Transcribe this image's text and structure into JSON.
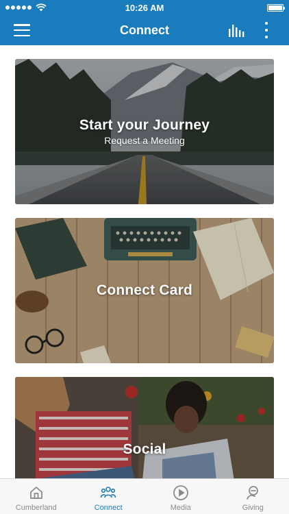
{
  "status_bar": {
    "time": "10:26 AM"
  },
  "header": {
    "title": "Connect"
  },
  "cards": [
    {
      "title": "Start your Journey",
      "subtitle": "Request a Meeting"
    },
    {
      "title": "Connect Card",
      "subtitle": ""
    },
    {
      "title": "Social",
      "subtitle": ""
    }
  ],
  "tabs": [
    {
      "label": "Cumberland",
      "icon": "home-icon",
      "active": false
    },
    {
      "label": "Connect",
      "icon": "people-icon",
      "active": true
    },
    {
      "label": "Media",
      "icon": "play-circle-icon",
      "active": false
    },
    {
      "label": "Giving",
      "icon": "giving-hand-icon",
      "active": false
    }
  ],
  "colors": {
    "brand_blue": "#1a7bbd",
    "tab_inactive": "#8a8a8a",
    "tab_bar_bg": "#f7f7f7"
  }
}
